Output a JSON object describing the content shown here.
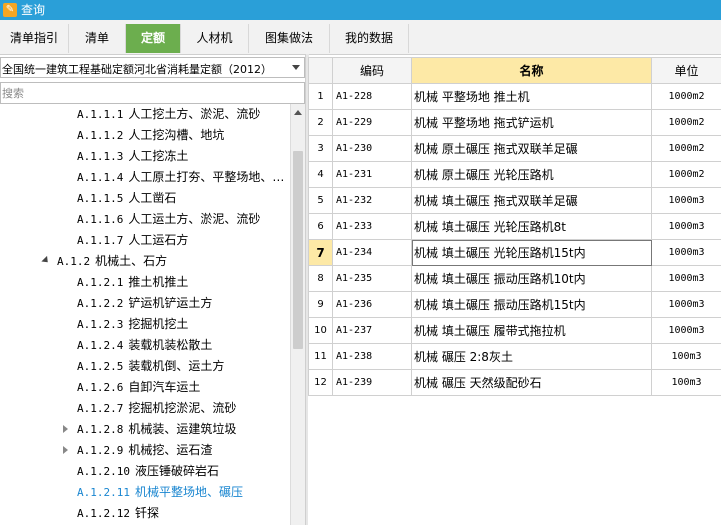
{
  "window": {
    "title": "查询",
    "icon": "edit-icon"
  },
  "tabs": [
    {
      "label": "清单指引",
      "active": false
    },
    {
      "label": "清单",
      "active": false
    },
    {
      "label": "定额",
      "active": true
    },
    {
      "label": "人材机",
      "active": false
    },
    {
      "label": "图集做法",
      "active": false
    },
    {
      "label": "我的数据",
      "active": false
    }
  ],
  "quota_library": {
    "selected": "全国统一建筑工程基础定额河北省消耗量定额（2012）"
  },
  "search": {
    "placeholder": "搜索",
    "value": ""
  },
  "tree": {
    "items": [
      {
        "code": "A.1.1.1",
        "label": "人工挖土方、淤泥、流砂"
      },
      {
        "code": "A.1.1.2",
        "label": "人工挖沟槽、地坑"
      },
      {
        "code": "A.1.1.3",
        "label": "人工挖冻土"
      },
      {
        "code": "A.1.1.4",
        "label": "人工原土打夯、平整场地、…"
      },
      {
        "code": "A.1.1.5",
        "label": "人工凿石"
      },
      {
        "code": "A.1.1.6",
        "label": "人工运土方、淤泥、流砂"
      },
      {
        "code": "A.1.1.7",
        "label": "人工运石方"
      },
      {
        "code": "A.1.2",
        "label": "机械土、石方",
        "expanded": true
      },
      {
        "code": "A.1.2.1",
        "label": "推土机推土"
      },
      {
        "code": "A.1.2.2",
        "label": "铲运机铲运土方"
      },
      {
        "code": "A.1.2.3",
        "label": "挖掘机挖土"
      },
      {
        "code": "A.1.2.4",
        "label": "装载机装松散土"
      },
      {
        "code": "A.1.2.5",
        "label": "装载机倒、运土方"
      },
      {
        "code": "A.1.2.6",
        "label": "自卸汽车运土"
      },
      {
        "code": "A.1.2.7",
        "label": "挖掘机挖淤泥、流砂"
      },
      {
        "code": "A.1.2.8",
        "label": "机械装、运建筑垃圾",
        "collapsed": true
      },
      {
        "code": "A.1.2.9",
        "label": "机械挖、运石渣",
        "collapsed": true
      },
      {
        "code": "A.1.2.10",
        "label": "液压锤破碎岩石"
      },
      {
        "code": "A.1.2.11",
        "label": "机械平整场地、碾压",
        "selected": true
      },
      {
        "code": "A.1.2.12",
        "label": "钎探"
      }
    ]
  },
  "grid": {
    "columns": {
      "code": "编码",
      "name": "名称",
      "unit": "单位"
    },
    "current_row": 7,
    "rows": [
      {
        "idx": "1",
        "code": "A1-228",
        "name": "机械 平整场地 推土机",
        "unit": "1000m2"
      },
      {
        "idx": "2",
        "code": "A1-229",
        "name": "机械 平整场地 拖式铲运机",
        "unit": "1000m2"
      },
      {
        "idx": "3",
        "code": "A1-230",
        "name": "机械 原土碾压 拖式双联羊足碾",
        "unit": "1000m2"
      },
      {
        "idx": "4",
        "code": "A1-231",
        "name": "机械 原土碾压 光轮压路机",
        "unit": "1000m2"
      },
      {
        "idx": "5",
        "code": "A1-232",
        "name": "机械 填土碾压 拖式双联羊足碾",
        "unit": "1000m3"
      },
      {
        "idx": "6",
        "code": "A1-233",
        "name": "机械 填土碾压 光轮压路机8t",
        "unit": "1000m3"
      },
      {
        "idx": "7",
        "code": "A1-234",
        "name": "机械 填土碾压 光轮压路机15t内",
        "unit": "1000m3"
      },
      {
        "idx": "8",
        "code": "A1-235",
        "name": "机械 填土碾压 振动压路机10t内",
        "unit": "1000m3"
      },
      {
        "idx": "9",
        "code": "A1-236",
        "name": "机械 填土碾压 振动压路机15t内",
        "unit": "1000m3"
      },
      {
        "idx": "10",
        "code": "A1-237",
        "name": "机械 填土碾压 履带式拖拉机",
        "unit": "1000m3"
      },
      {
        "idx": "11",
        "code": "A1-238",
        "name": "机械 碾压 2:8灰土",
        "unit": "100m3"
      },
      {
        "idx": "12",
        "code": "A1-239",
        "name": "机械 碾压 天然级配砂石",
        "unit": "100m3"
      }
    ]
  },
  "colors": {
    "title_bar": "#2a9fd8",
    "active_tab": "#6cae4e",
    "header_highlight": "#fde9a6",
    "selected_tree_text": "#1a86d0"
  }
}
